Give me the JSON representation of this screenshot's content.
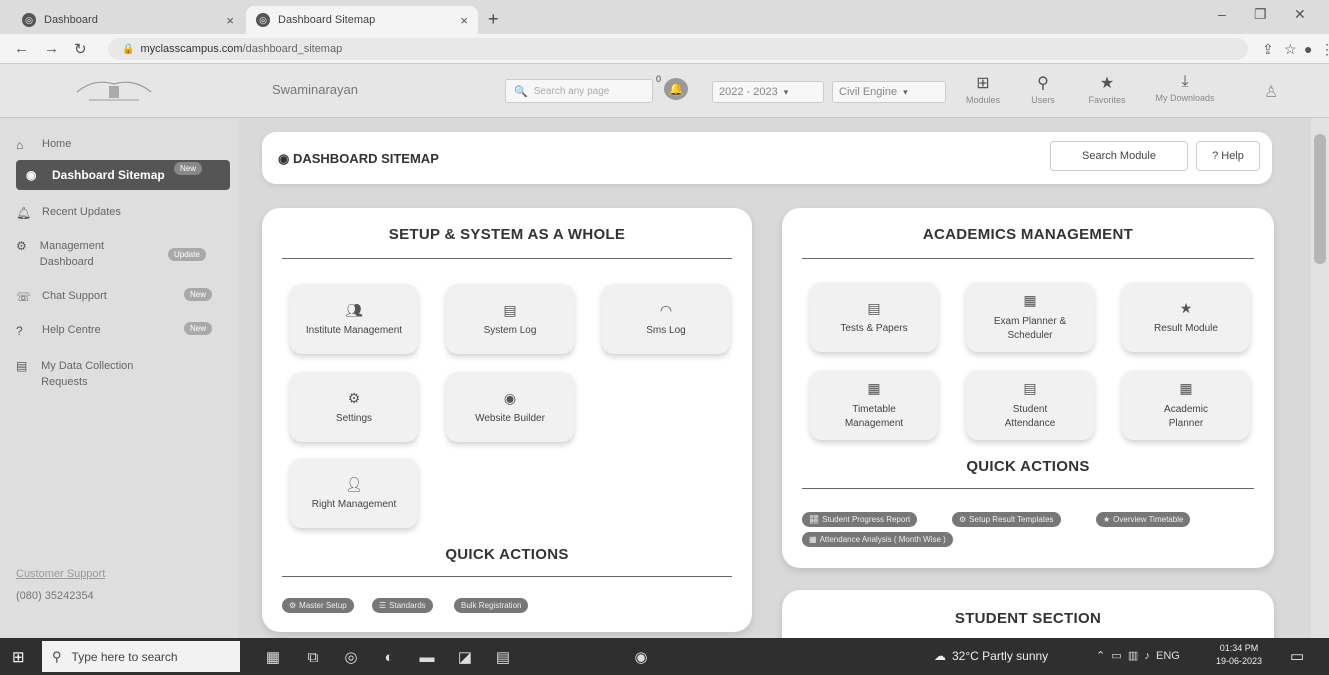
{
  "browser": {
    "tabs": [
      {
        "title": "Dashboard",
        "active": false
      },
      {
        "title": "Dashboard Sitemap",
        "active": true
      }
    ],
    "url_host": "myclasscampus.com",
    "url_path": "/dashboard_sitemap"
  },
  "header": {
    "logo_text": "Swaminarayan logo",
    "institute": "Swaminarayan",
    "search_placeholder": "Search any page",
    "notification_count": "0",
    "year_select": "2022 - 2023",
    "dept_select": "Civil Engine",
    "icons": [
      {
        "label": "Modules",
        "icon": "grid-icon"
      },
      {
        "label": "Users",
        "icon": "users-icon"
      },
      {
        "label": "Favorites",
        "icon": "star-icon"
      },
      {
        "label": "My Downloads",
        "icon": "download-icon"
      }
    ]
  },
  "sidebar": {
    "items": [
      {
        "label": "Home",
        "icon": "home-icon"
      },
      {
        "label": "Dashboard Sitemap",
        "icon": "dashboard-icon",
        "badge": "New"
      },
      {
        "label": "Recent Updates",
        "icon": "bell-icon"
      },
      {
        "label": "Management Dashboard",
        "icon": "management-icon",
        "badge": "Update"
      },
      {
        "label": "Chat Support",
        "icon": "chat-icon",
        "badge": "New"
      },
      {
        "label": "Help Centre",
        "icon": "help-icon",
        "badge": "New"
      },
      {
        "label": "My Data Collection Requests",
        "icon": "document-icon"
      }
    ],
    "customer_support": "Customer Support",
    "phone": "(080) 35242354"
  },
  "main": {
    "page_title": "DASHBOARD SITEMAP",
    "search_module_label": "Search Module",
    "help_label": "? Help",
    "setup": {
      "title": "SETUP & SYSTEM AS A WHOLE",
      "tiles": [
        {
          "label": "Institute Management",
          "icon": "institute-icon"
        },
        {
          "label": "System Log",
          "icon": "log-icon"
        },
        {
          "label": "Sms Log",
          "icon": "sms-icon"
        },
        {
          "label": "Settings",
          "icon": "settings-icon"
        },
        {
          "label": "Website Builder",
          "icon": "globe-icon"
        },
        {
          "label": "Right Management",
          "icon": "user-icon"
        }
      ],
      "quick_actions_title": "QUICK ACTIONS",
      "quick_actions": [
        "Master Setup",
        "Standards",
        "Bulk Registration"
      ]
    },
    "academics": {
      "title": "ACADEMICS MANAGEMENT",
      "tiles": [
        {
          "label": "Tests & Papers",
          "icon": "tests-icon"
        },
        {
          "label": "Exam Planner & Scheduler",
          "icon": "calendar-icon"
        },
        {
          "label": "Result Module",
          "icon": "star-icon"
        },
        {
          "label": "Timetable Management",
          "icon": "calendar-icon"
        },
        {
          "label": "Student Attendance",
          "icon": "attendance-icon"
        },
        {
          "label": "Academic Planner",
          "icon": "calendar-icon"
        }
      ],
      "quick_actions_title": "QUICK ACTIONS",
      "quick_actions": [
        "Student Progress Report",
        "Setup Result Templates",
        "Overview Timetable",
        "Attendance Analysis ( Month Wise )"
      ]
    },
    "student": {
      "title": "STUDENT SECTION"
    }
  },
  "taskbar": {
    "search_placeholder": "Type here to search",
    "weather": "32°C  Partly sunny",
    "language": "ENG",
    "time": "01:34 PM",
    "date": "19-06-2023"
  }
}
